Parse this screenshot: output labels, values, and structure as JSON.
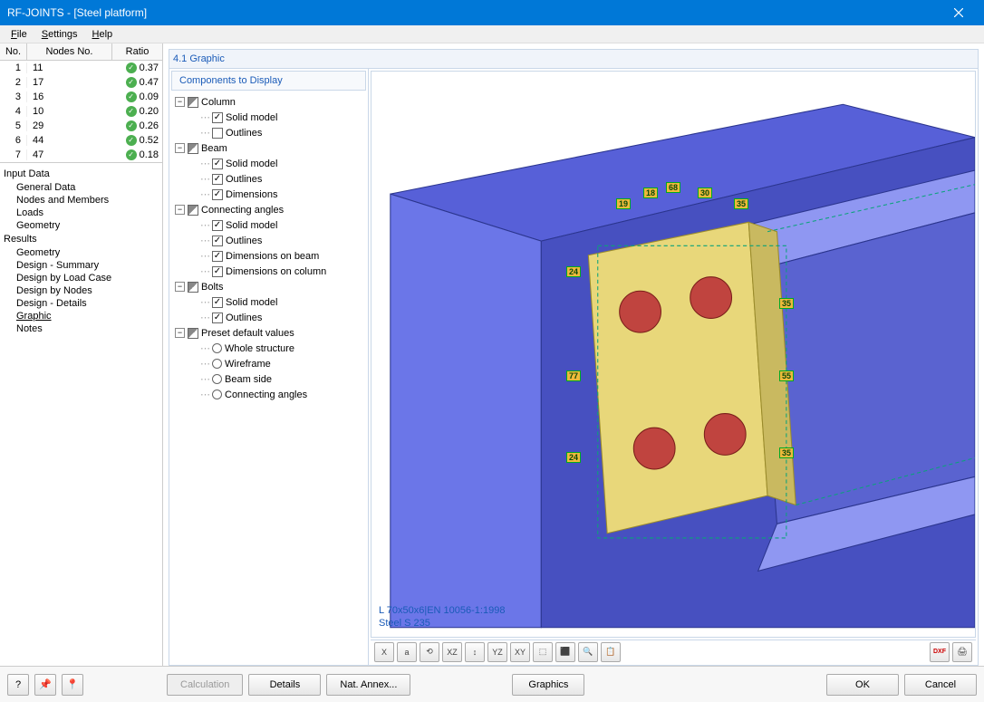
{
  "titlebar": {
    "text": "RF-JOINTS - [Steel platform]"
  },
  "menubar": {
    "file": "File",
    "settings": "Settings",
    "help": "Help"
  },
  "left_table": {
    "head_no": "No.",
    "head_nodes": "Nodes No.",
    "head_ratio": "Ratio",
    "rows": [
      {
        "no": "1",
        "nodes": "11",
        "ratio": "0.37"
      },
      {
        "no": "2",
        "nodes": "17",
        "ratio": "0.47"
      },
      {
        "no": "3",
        "nodes": "16",
        "ratio": "0.09"
      },
      {
        "no": "4",
        "nodes": "10",
        "ratio": "0.20"
      },
      {
        "no": "5",
        "nodes": "29",
        "ratio": "0.26"
      },
      {
        "no": "6",
        "nodes": "44",
        "ratio": "0.52"
      },
      {
        "no": "7",
        "nodes": "47",
        "ratio": "0.18"
      }
    ]
  },
  "nav": {
    "input_data": "Input Data",
    "input_items": [
      "General Data",
      "Nodes and Members",
      "Loads",
      "Geometry"
    ],
    "results": "Results",
    "result_items": [
      "Geometry",
      "Design - Summary",
      "Design by Load Case",
      "Design by Nodes",
      "Design - Details",
      "Graphic",
      "Notes"
    ],
    "selected": "Graphic"
  },
  "panel": {
    "title": "4.1 Graphic",
    "comp_head": "Components to Display"
  },
  "tree": {
    "column": "Column",
    "column_solid": "Solid model",
    "column_outlines": "Outlines",
    "beam": "Beam",
    "beam_solid": "Solid model",
    "beam_outlines": "Outlines",
    "beam_dims": "Dimensions",
    "angles": "Connecting angles",
    "angles_solid": "Solid model",
    "angles_outlines": "Outlines",
    "angles_dimbeam": "Dimensions on beam",
    "angles_dimcol": "Dimensions on column",
    "bolts": "Bolts",
    "bolts_solid": "Solid model",
    "bolts_outlines": "Outlines",
    "preset": "Preset default values",
    "preset_whole": "Whole structure",
    "preset_wire": "Wireframe",
    "preset_beamside": "Beam side",
    "preset_angles": "Connecting angles"
  },
  "dims": {
    "d19": "19",
    "d18": "18",
    "d68": "68",
    "d30": "30",
    "d35a": "35",
    "d24a": "24",
    "d77": "77",
    "d24b": "24",
    "d35b": "35",
    "d55": "55",
    "d35c": "35"
  },
  "model": {
    "profile": "L 70x50x6|EN 10056-1:1998",
    "material": "Steel S 235"
  },
  "toolbar": {
    "t1": "X",
    "t2": "a",
    "t3": "⟲",
    "t4": "XZ",
    "t5": "↕",
    "t6": "YZ",
    "t7": "XY",
    "t8": "⬚",
    "t9": "⬛",
    "t10": "🔍",
    "t11": "📋",
    "dxf": "DXF",
    "print": "🖨"
  },
  "footer": {
    "help": "?",
    "pin": "📌",
    "pin2": "📍",
    "calc": "Calculation",
    "details": "Details",
    "annex": "Nat. Annex...",
    "graphics": "Graphics",
    "ok": "OK",
    "cancel": "Cancel"
  }
}
